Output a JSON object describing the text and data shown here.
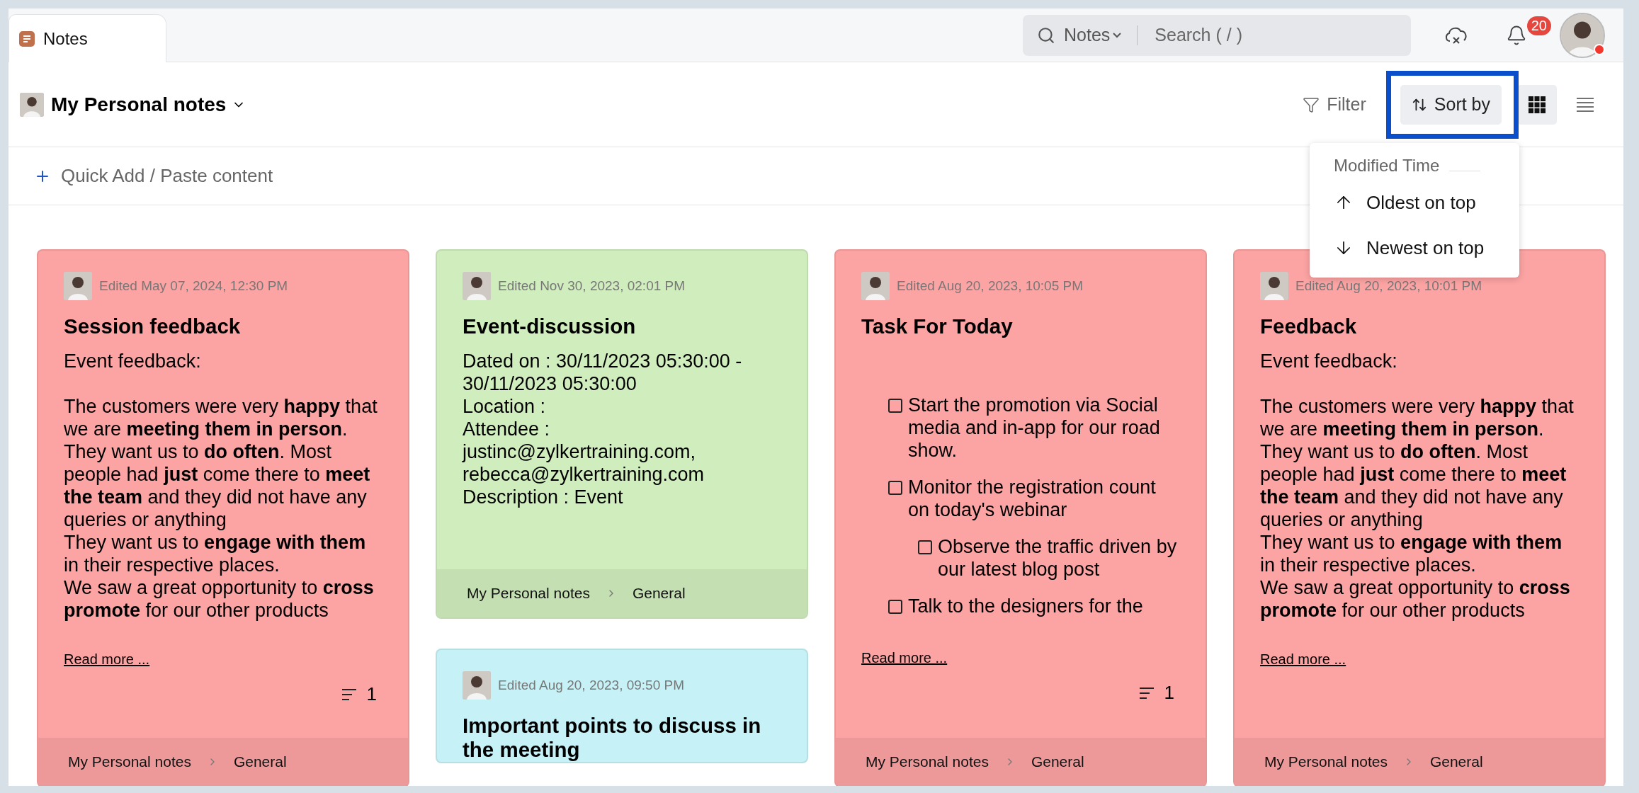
{
  "tabs": [
    {
      "label": "Notes",
      "selected": true
    }
  ],
  "search": {
    "scope": "Notes",
    "placeholder": "Search ( / )"
  },
  "notifications": {
    "count": "20"
  },
  "profile": {
    "online": true
  },
  "notebook": {
    "title": "My Personal notes"
  },
  "toolbar": {
    "filter": "Filter",
    "sort": {
      "label": "Sort by",
      "highlighted": true
    },
    "views": [
      {
        "kind": "grid",
        "selected": true
      },
      {
        "kind": "list",
        "selected": false
      }
    ]
  },
  "sort_menu": {
    "heading": "Modified Time",
    "options": [
      {
        "kind": "up",
        "label": "Oldest on top"
      },
      {
        "kind": "down",
        "label": "Newest on top"
      }
    ]
  },
  "quick_add": {
    "placeholder": "Quick Add / Paste content"
  },
  "columns": [
    {
      "cards": [
        {
          "kind": "text",
          "color": "#fca3a3",
          "edited": "Edited May 07, 2024, 12:30 PM",
          "title": "Session feedback",
          "lead": "Event feedback:",
          "lines": [
            "The customers were very **happy** that we are **meeting them in person**. They want us to **do often**. Most people had **just** come there to **meet the team** and they did not have any queries or anything",
            "They want us to **engage with them** in their respective places.",
            "We saw a great opportunity to **cross promote** for our other products"
          ],
          "read_more": "Read more ...",
          "comments": "1",
          "notebook": "My Personal notes",
          "section": "General"
        }
      ]
    },
    {
      "cards": [
        {
          "kind": "event",
          "color": "#d0edbd",
          "edited": "Edited Nov 30, 2023, 02:01 PM",
          "title": "Event-discussion",
          "lines": [
            "Dated on : 30/11/2023 05:30:00 - 30/11/2023 05:30:00",
            "Location :",
            "Attendee :",
            "justinc@zylkertraining.com,",
            "rebecca@zylkertraining.com",
            "Description : Event"
          ],
          "notebook": "My Personal notes",
          "section": "General"
        },
        {
          "kind": "plain",
          "color": "#c6f2f7",
          "edited": "Edited Aug 20, 2023, 09:50 PM",
          "title": "Important points to discuss in the meeting"
        }
      ]
    },
    {
      "cards": [
        {
          "kind": "checklist",
          "color": "#fca3a3",
          "edited": "Edited Aug 20, 2023, 10:05 PM",
          "title": "Task For Today",
          "items": [
            {
              "text": "Start the promotion via Social media and in-app for our road show.",
              "checked": false
            },
            {
              "text": "Monitor the registration count on today's webinar",
              "checked": false,
              "children": [
                {
                  "text": "Observe the traffic driven by our latest blog post",
                  "checked": false
                }
              ]
            },
            {
              "text": "Talk to the designers for the",
              "checked": false
            }
          ],
          "read_more": "Read more ...",
          "comments": "1",
          "notebook": "My Personal notes",
          "section": "General"
        }
      ]
    },
    {
      "cards": [
        {
          "kind": "text",
          "color": "#fca3a3",
          "edited": "Edited Aug 20, 2023, 10:01 PM",
          "title": "Feedback",
          "lead": "Event feedback:",
          "lines": [
            "The customers were very **happy** that we are **meeting them in person**. They want us to **do often**. Most people had **just** come there to **meet the team** and they did not have any queries or anything",
            "They want us to **engage with them** in their respective places.",
            "We saw a great opportunity to **cross promote** for our other products"
          ],
          "read_more": "Read more ...",
          "notebook": "My Personal notes",
          "section": "General"
        }
      ]
    }
  ]
}
